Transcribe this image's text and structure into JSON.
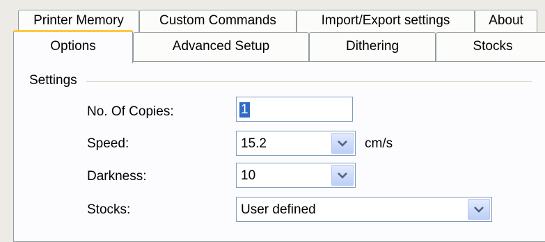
{
  "tabs": {
    "row1": [
      "Printer Memory",
      "Custom Commands",
      "Import/Export settings",
      "About"
    ],
    "row2": [
      "Options",
      "Advanced Setup",
      "Dithering",
      "Stocks"
    ],
    "active": "Options"
  },
  "settings": {
    "group_label": "Settings",
    "copies": {
      "label": "No. Of Copies:",
      "value": "1"
    },
    "speed": {
      "label": "Speed:",
      "value": "15.2",
      "unit": "cm/s"
    },
    "darkness": {
      "label": "Darkness:",
      "value": "10"
    },
    "stocks": {
      "label": "Stocks:",
      "value": "User defined"
    }
  },
  "icons": {
    "dropdown": "chevron-down-icon"
  },
  "colors": {
    "active_tab_accent": "#ffc83c",
    "selection": "#316ac5",
    "chevron": "#4d6185"
  }
}
